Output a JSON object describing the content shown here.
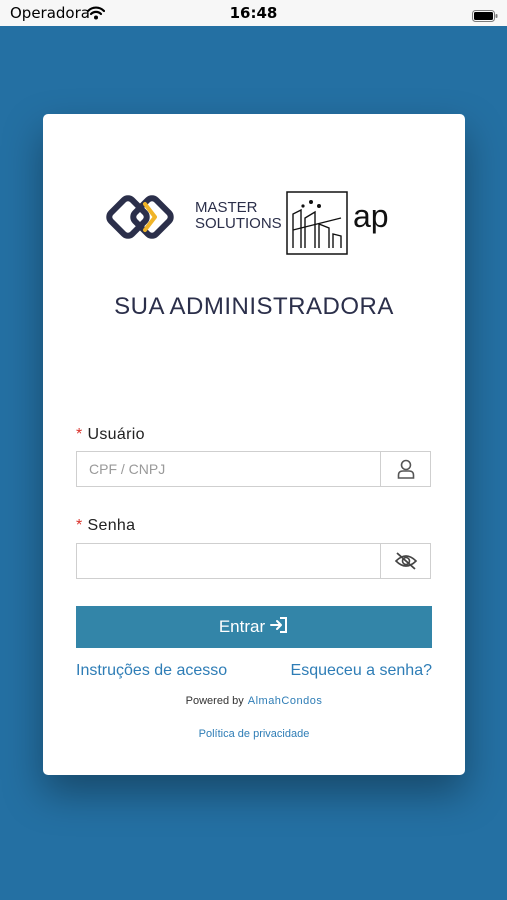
{
  "status_bar": {
    "carrier": "Operadora",
    "time": "16:48"
  },
  "logo": {
    "brand_line1": "MASTER",
    "brand_line2": "SOLUTIONS",
    "brand_suffix": "ap",
    "accent_color": "#f0b428",
    "dark_color": "#2b2f4a"
  },
  "title": "SUA ADMINISTRADORA",
  "form": {
    "username_label": "Usuário",
    "username_placeholder": "CPF / CNPJ",
    "username_value": "",
    "password_label": "Senha",
    "password_value": "",
    "required_marker": "*",
    "submit_label": "Entrar"
  },
  "links": {
    "instructions": "Instruções de acesso",
    "forgot_password": "Esqueceu a senha?"
  },
  "footer": {
    "powered_by": "Powered by",
    "powered_brand": "AlmahCondos",
    "privacy": "Política de privacidade"
  },
  "colors": {
    "background": "#2470a3",
    "button": "#3385a8",
    "link": "#2e7db6",
    "required": "#d9312b"
  }
}
